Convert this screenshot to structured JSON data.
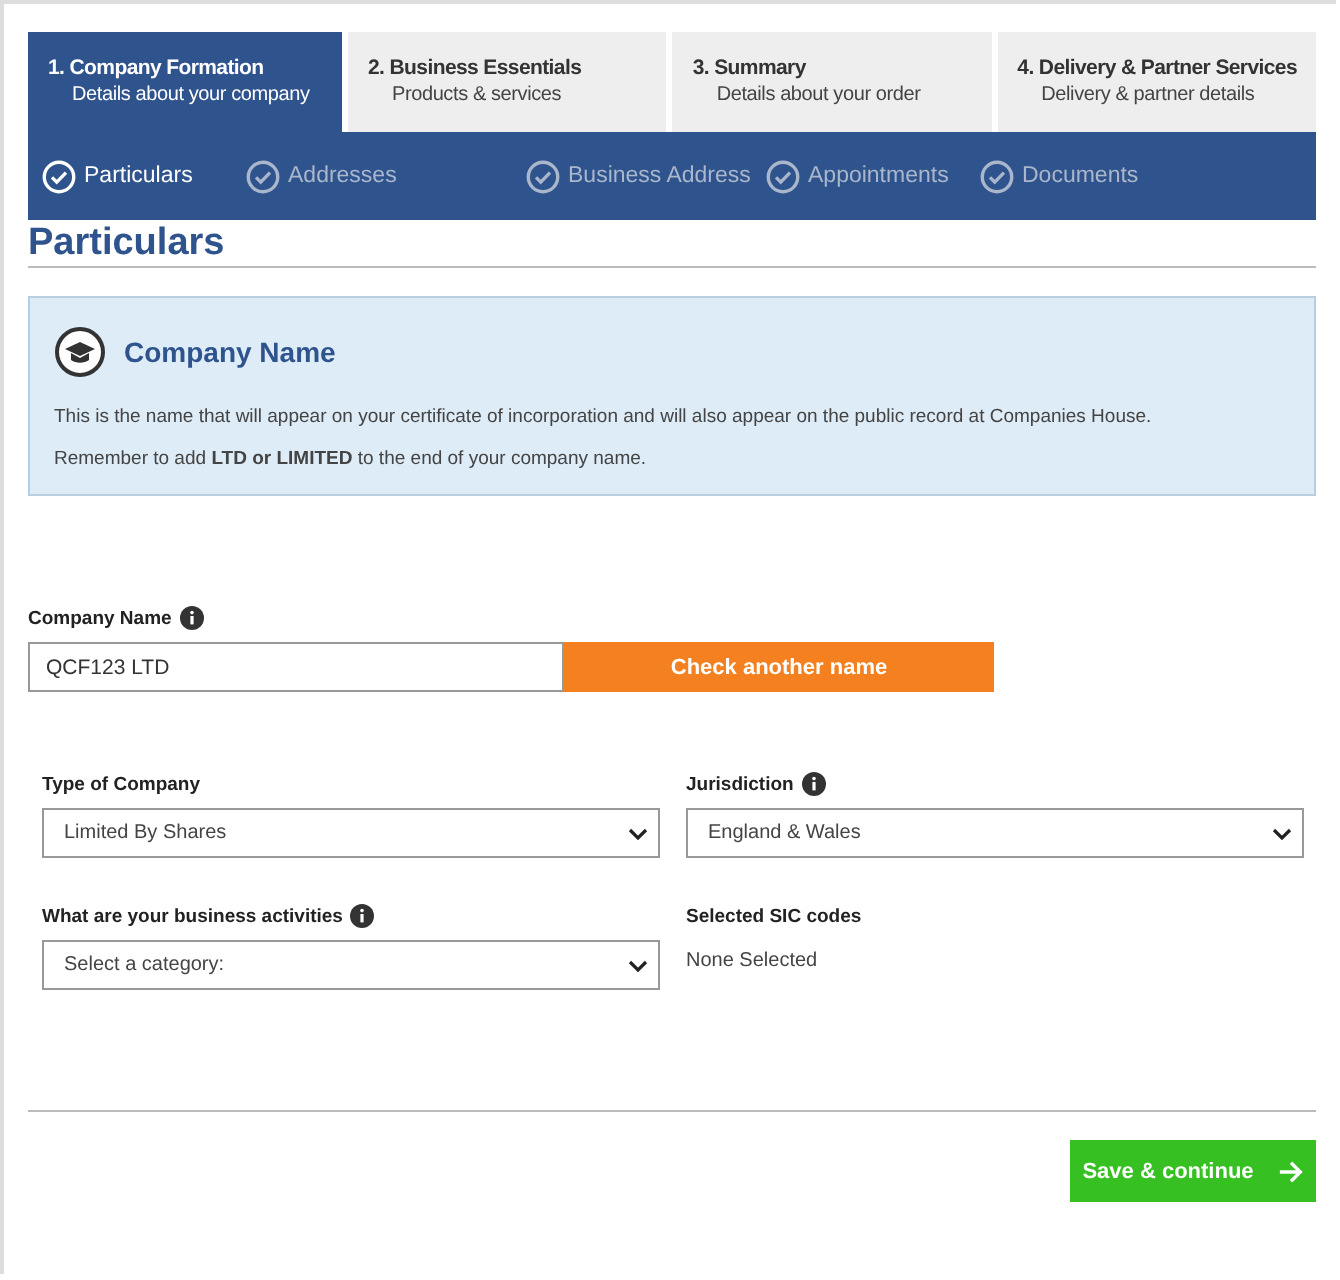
{
  "steps": [
    {
      "title": "1. Company Formation",
      "subtitle": "Details about your company",
      "selected": true
    },
    {
      "title": "2. Business Essentials",
      "subtitle": "Products & services",
      "selected": false
    },
    {
      "title": "3. Summary",
      "subtitle": "Details about your order",
      "selected": false
    },
    {
      "title": "4. Delivery & Partner Services",
      "subtitle": "Delivery & partner details",
      "selected": false
    }
  ],
  "substeps": [
    {
      "label": "Particulars",
      "selected": true
    },
    {
      "label": "Addresses",
      "selected": false
    },
    {
      "label": "Business Address",
      "selected": false
    },
    {
      "label": "Appointments",
      "selected": false
    },
    {
      "label": "Documents",
      "selected": false
    }
  ],
  "page_title": "Particulars",
  "info_box": {
    "title": "Company Name",
    "paragraphs": [
      "This is the name that will appear on your certificate of incorporation and will also appear on the public record at Companies House.",
      "Remember to add **LTD or LIMITED** to the end of your company name."
    ]
  },
  "company_name": {
    "label": "Company Name",
    "value": "QCF123 LTD",
    "button": "Check another name"
  },
  "fields": [
    {
      "kind": "select",
      "label": "Type of Company",
      "info": false,
      "value": "Limited By Shares"
    },
    {
      "kind": "select",
      "label": "Jurisdiction",
      "info": true,
      "value": "England & Wales"
    },
    {
      "kind": "select",
      "label": "What are your business activities",
      "info": true,
      "value": "Select a category:"
    },
    {
      "kind": "text",
      "label": "Selected SIC codes",
      "info": false,
      "value": "None Selected"
    }
  ],
  "save_button": "Save & continue"
}
